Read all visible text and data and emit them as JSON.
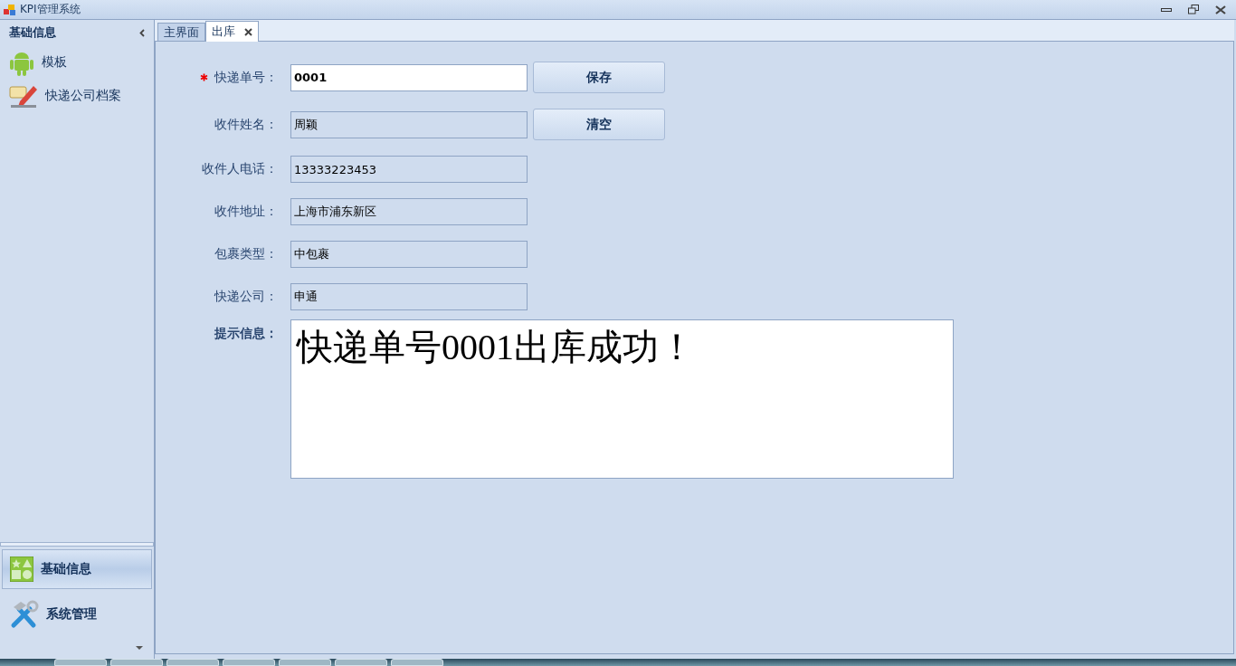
{
  "window": {
    "title": "KPI管理系统"
  },
  "sidebar": {
    "header": "基础信息",
    "items": [
      {
        "label": "模板"
      },
      {
        "label": "快递公司档案"
      }
    ],
    "groups": [
      {
        "label": "基础信息",
        "selected": true
      },
      {
        "label": "系统管理",
        "selected": false
      }
    ]
  },
  "tabs": [
    {
      "label": "主界面",
      "selected": false,
      "closable": false
    },
    {
      "label": "出库",
      "selected": true,
      "closable": true
    }
  ],
  "form": {
    "fields": [
      {
        "label": "快递单号：",
        "value": "0001",
        "required": true,
        "editable": true
      },
      {
        "label": "收件姓名：",
        "value": "周颖",
        "required": false,
        "editable": false
      },
      {
        "label": "收件人电话：",
        "value": "13333223453",
        "required": false,
        "editable": false
      },
      {
        "label": "收件地址：",
        "value": "上海市浦东新区",
        "required": false,
        "editable": false
      },
      {
        "label": "包裹类型：",
        "value": "中包裹",
        "required": false,
        "editable": false
      },
      {
        "label": "快递公司：",
        "value": "申通",
        "required": false,
        "editable": false
      }
    ],
    "buttons": [
      "保存",
      "清空"
    ],
    "message": {
      "label": "提示信息：",
      "value": "快递单号0001出库成功！"
    }
  }
}
